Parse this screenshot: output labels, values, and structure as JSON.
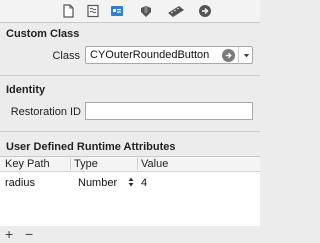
{
  "toolbar": {
    "tabs": [
      {
        "icon": "file-inspector-icon"
      },
      {
        "icon": "quick-help-icon"
      },
      {
        "icon": "identity-inspector-icon",
        "selected": true
      },
      {
        "icon": "attributes-inspector-icon"
      },
      {
        "icon": "size-inspector-icon"
      },
      {
        "icon": "connections-inspector-icon"
      }
    ]
  },
  "custom_class": {
    "title": "Custom Class",
    "class_label": "Class",
    "class_value": "CYOuterRoundedButton"
  },
  "identity": {
    "title": "Identity",
    "restoration_id_label": "Restoration ID",
    "restoration_id_value": ""
  },
  "runtime_attributes": {
    "title": "User Defined Runtime Attributes",
    "columns": [
      "Key Path",
      "Type",
      "Value"
    ],
    "rows": [
      {
        "key_path": "radius",
        "type": "Number",
        "value": "4"
      }
    ]
  },
  "footer": {
    "add_label": "+",
    "remove_label": "−"
  }
}
